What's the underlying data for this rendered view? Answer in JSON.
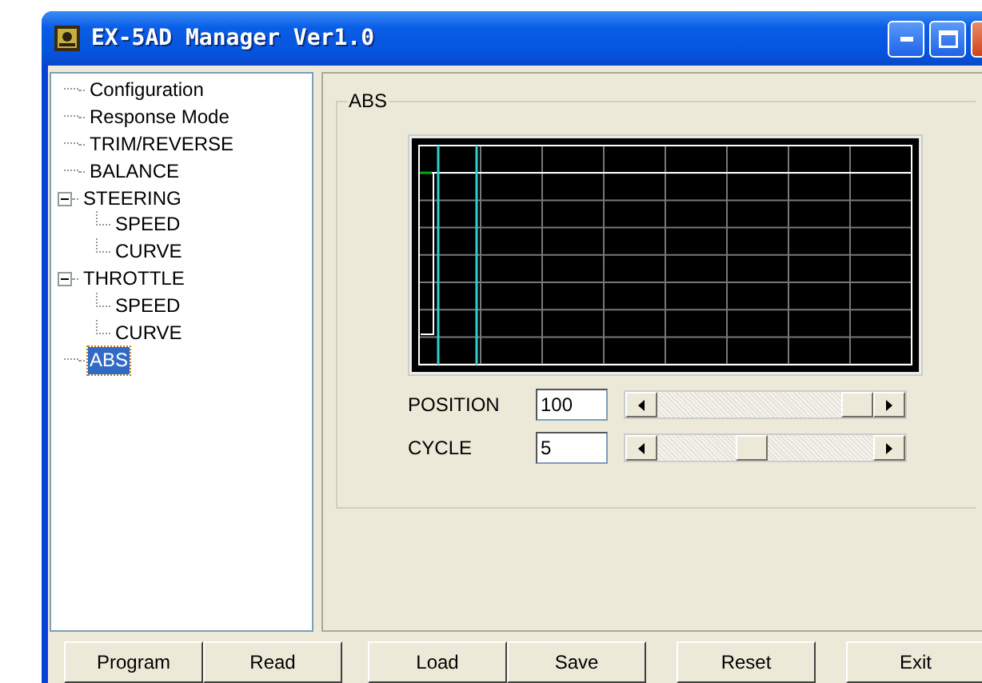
{
  "window": {
    "title": "EX-5AD Manager Ver1.0"
  },
  "tree": [
    {
      "label": "Configuration",
      "selected": false
    },
    {
      "label": "Response Mode",
      "selected": false
    },
    {
      "label": "TRIM/REVERSE",
      "selected": false
    },
    {
      "label": "BALANCE",
      "selected": false
    },
    {
      "label": "STEERING",
      "selected": false,
      "expanded": true,
      "children": [
        {
          "label": "SPEED",
          "selected": false
        },
        {
          "label": "CURVE",
          "selected": false
        }
      ]
    },
    {
      "label": "THROTTLE",
      "selected": false,
      "expanded": true,
      "children": [
        {
          "label": "SPEED",
          "selected": false
        },
        {
          "label": "CURVE",
          "selected": false
        }
      ]
    },
    {
      "label": "ABS",
      "selected": true
    }
  ],
  "group": {
    "title": "ABS",
    "controls": [
      {
        "label": "POSITION",
        "value": "100",
        "level": 1.0
      },
      {
        "label": "CYCLE",
        "value": "5",
        "level": 0.43
      }
    ]
  },
  "buttons": [
    "Program",
    "Read",
    "Load",
    "Save",
    "Reset",
    "Exit"
  ]
}
